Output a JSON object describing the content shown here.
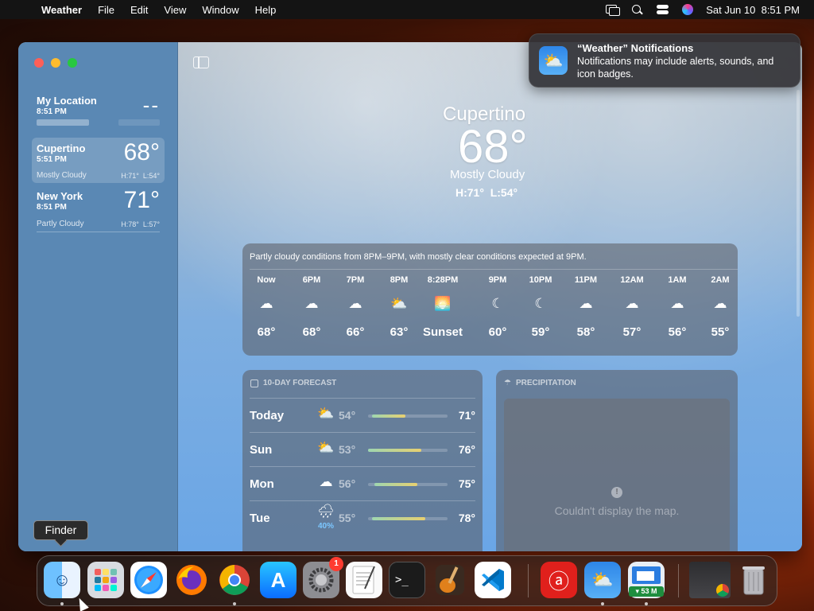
{
  "menubar": {
    "app_name": "Weather",
    "menus": [
      "File",
      "Edit",
      "View",
      "Window",
      "Help"
    ],
    "datetime": "Sat Jun 10  8:51 PM"
  },
  "sidebar": {
    "locations": [
      {
        "name": "My Location",
        "time": "8:51 PM",
        "temp": "--",
        "condition": "",
        "hl": ""
      },
      {
        "name": "Cupertino",
        "time": "5:51 PM",
        "temp": "68°",
        "condition": "Mostly Cloudy",
        "hl": "H:71°  L:54°"
      },
      {
        "name": "New York",
        "time": "8:51 PM",
        "temp": "71°",
        "condition": "Partly Cloudy",
        "hl": "H:78°  L:57°"
      }
    ]
  },
  "current": {
    "city": "Cupertino",
    "temp": "68°",
    "condition": "Mostly Cloudy",
    "hl": "H:71°  L:54°"
  },
  "hourly": {
    "summary": "Partly cloudy conditions from 8PM–9PM, with mostly clear conditions expected at 9PM.",
    "hours": [
      {
        "label": "Now",
        "icon": "cloud-icon",
        "glyph": "☁",
        "temp": "68°"
      },
      {
        "label": "6PM",
        "icon": "cloud-icon",
        "glyph": "☁",
        "temp": "68°"
      },
      {
        "label": "7PM",
        "icon": "cloud-icon",
        "glyph": "☁",
        "temp": "66°"
      },
      {
        "label": "8PM",
        "icon": "partly-cloudy-sun-icon",
        "glyph": "⛅",
        "temp": "63°"
      },
      {
        "label": "8:28PM",
        "icon": "sunset-icon",
        "glyph": "🌅",
        "temp": "Sunset"
      },
      {
        "label": "9PM",
        "icon": "moon-icon",
        "glyph": "☾",
        "temp": "60°"
      },
      {
        "label": "10PM",
        "icon": "moon-icon",
        "glyph": "☾",
        "temp": "59°"
      },
      {
        "label": "11PM",
        "icon": "cloudy-moon-icon",
        "glyph": "☁",
        "temp": "58°"
      },
      {
        "label": "12AM",
        "icon": "cloud-icon",
        "glyph": "☁",
        "temp": "57°"
      },
      {
        "label": "1AM",
        "icon": "cloud-icon",
        "glyph": "☁",
        "temp": "56°"
      },
      {
        "label": "2AM",
        "icon": "cloud-icon",
        "glyph": "☁",
        "temp": "55°"
      }
    ]
  },
  "forecast": {
    "title": "10-DAY FORECAST",
    "days": [
      {
        "day": "Today",
        "icon": "partly-cloudy-sun-icon",
        "glyph": "⛅",
        "pct": "",
        "low": "54°",
        "high": "71°",
        "bar_start": 0.05,
        "bar_end": 0.47
      },
      {
        "day": "Sun",
        "icon": "partly-cloudy-sun-icon",
        "glyph": "⛅",
        "pct": "",
        "low": "53°",
        "high": "76°",
        "bar_start": 0.0,
        "bar_end": 0.67
      },
      {
        "day": "Mon",
        "icon": "cloud-icon",
        "glyph": "☁",
        "pct": "",
        "low": "56°",
        "high": "75°",
        "bar_start": 0.08,
        "bar_end": 0.62
      },
      {
        "day": "Tue",
        "icon": "rain-cloud-icon",
        "glyph": "🌧",
        "pct": "40%",
        "low": "55°",
        "high": "78°",
        "bar_start": 0.05,
        "bar_end": 0.72
      }
    ]
  },
  "precipitation": {
    "title": "PRECIPITATION",
    "message": "Couldn't display the map."
  },
  "notification": {
    "title": "“Weather” Notifications",
    "body": "Notifications may include alerts, sounds, and icon badges."
  },
  "tooltip": "Finder",
  "dock": {
    "apps": [
      {
        "name": "Finder",
        "icon": "finder-icon",
        "running": true
      },
      {
        "name": "Launchpad",
        "icon": "launchpad-icon",
        "running": false
      },
      {
        "name": "Safari",
        "icon": "safari-icon",
        "running": false
      },
      {
        "name": "Firefox",
        "icon": "firefox-icon",
        "running": false
      },
      {
        "name": "Chrome",
        "icon": "chrome-icon",
        "running": true
      },
      {
        "name": "App Store",
        "icon": "app-store-icon",
        "running": false
      },
      {
        "name": "System Settings",
        "icon": "settings-icon",
        "running": false,
        "badge": "1"
      },
      {
        "name": "TextEdit",
        "icon": "textedit-icon",
        "running": false
      },
      {
        "name": "Terminal",
        "icon": "terminal-icon",
        "running": false
      },
      {
        "name": "GarageBand",
        "icon": "garageband-icon",
        "running": false
      },
      {
        "name": "VS Code",
        "icon": "vscode-icon",
        "running": false
      },
      {
        "name": "Acrobat",
        "icon": "acrobat-icon",
        "running": false
      },
      {
        "name": "Weather",
        "icon": "weather-icon",
        "running": true
      },
      {
        "name": "Activity",
        "icon": "memory-monitor-icon",
        "running": true,
        "mem": "▾ 53 M"
      },
      {
        "name": "Downloads",
        "icon": "downloads-stack-icon",
        "running": false
      },
      {
        "name": "Trash",
        "icon": "trash-icon",
        "running": false
      }
    ]
  }
}
